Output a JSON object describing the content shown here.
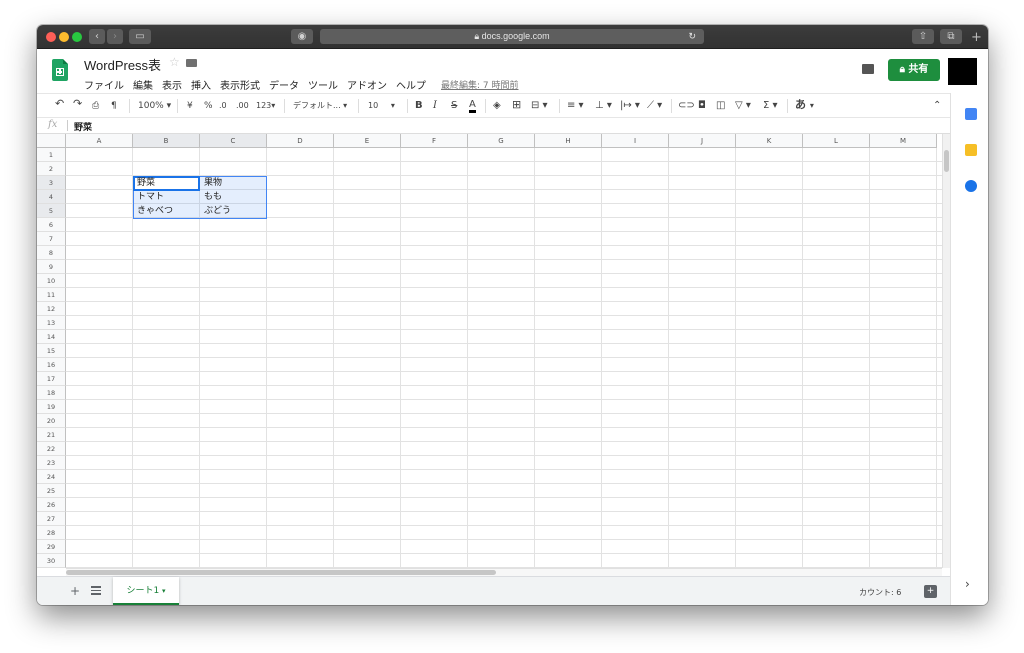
{
  "browser": {
    "url": "docs.google.com"
  },
  "doc": {
    "title": "WordPress表",
    "share_label": "共有"
  },
  "menu": {
    "items": [
      "ファイル",
      "編集",
      "表示",
      "挿入",
      "表示形式",
      "データ",
      "ツール",
      "アドオン",
      "ヘルプ"
    ],
    "last_edit": "最終編集: 7 時間前"
  },
  "toolbar": {
    "zoom": "100%",
    "currency": "¥",
    "percent": "%",
    "dec_decrease": ".0",
    "dec_increase": ".00",
    "format_more": "123",
    "font": "デフォルト...",
    "font_size": "10",
    "bold": "B",
    "italic": "I",
    "strike": "S",
    "text_color": "A",
    "function": "Σ",
    "input_tool": "あ"
  },
  "formula_bar": {
    "fx": "fx",
    "value": "野菜"
  },
  "columns": [
    "A",
    "B",
    "C",
    "D",
    "E",
    "F",
    "G",
    "H",
    "I",
    "J",
    "K",
    "L",
    "M"
  ],
  "rows": [
    "1",
    "2",
    "3",
    "4",
    "5",
    "6",
    "7",
    "8",
    "9",
    "10",
    "11",
    "12",
    "13",
    "14",
    "15",
    "16",
    "17",
    "18",
    "19",
    "20",
    "21",
    "22",
    "23",
    "24",
    "25",
    "26",
    "27",
    "28",
    "29",
    "30"
  ],
  "cells": {
    "B3": "野菜",
    "C3": "果物",
    "B4": "トマト",
    "C4": "もも",
    "B5": "きゃべつ",
    "C5": "ぶどう"
  },
  "sheet": {
    "tab_label": "シート1",
    "count_label": "カウント: 6"
  },
  "colors": {
    "accent_green": "#1e8e3e",
    "selection_blue": "#1a73e8",
    "sheets_logo": "#1fa463"
  }
}
